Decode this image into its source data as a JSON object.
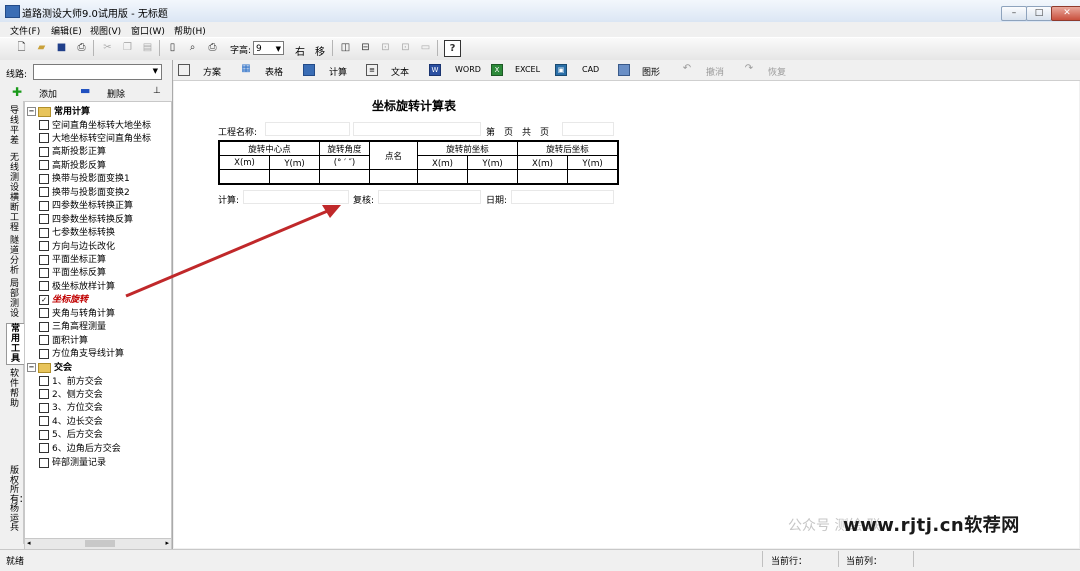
{
  "window": {
    "title": "道路测设大师9.0试用版 - 无标题",
    "controls": [
      "–",
      "□",
      "✕"
    ]
  },
  "menu": [
    "文件(F)",
    "编辑(E)",
    "视图(V)",
    "窗口(W)",
    "帮助(H)"
  ],
  "toolbar": {
    "font_size_label": "字高:",
    "font_size_value": "9",
    "right_label": "右",
    "move_label": "移"
  },
  "left_panel": {
    "route_label": "线路:",
    "add_label": "添加",
    "delete_label": "删除",
    "side_tabs": [
      "导线平差",
      "无线测设",
      "横断工程",
      "隧道分析",
      "局部测设",
      "常用工具",
      "软件帮助",
      "版权所有：杨运兵"
    ],
    "active_side_tab": "常用工具",
    "tree": {
      "group1": "常用计算",
      "group1_items": [
        "空间直角坐标转大地坐标",
        "大地坐标转空间直角坐标",
        "高斯投影正算",
        "高斯投影反算",
        "换带与投影面变换1",
        "换带与投影面变换2",
        "四参数坐标转换正算",
        "四参数坐标转换反算",
        "七参数坐标转换",
        "方向与边长改化",
        "平面坐标正算",
        "平面坐标反算",
        "极坐标放样计算",
        "坐标旋转",
        "夹角与转角计算",
        "三角高程测量",
        "面积计算",
        "方位角支导线计算"
      ],
      "selected_item": "坐标旋转",
      "group2": "交会",
      "group2_items": [
        "1、前方交会",
        "2、侧方交会",
        "3、方位交会",
        "4、边长交会",
        "5、后方交会",
        "6、边角后方交会"
      ],
      "extra_item": "碎部测量记录"
    }
  },
  "doc_toolbar": {
    "items": [
      "方案",
      "表格",
      "计算",
      "文本",
      "WORD",
      "EXCEL",
      "CAD",
      "图形",
      "撤消",
      "恢复"
    ]
  },
  "report": {
    "title": "坐标旋转计算表",
    "project_label": "工程名称:",
    "page_label": "第　页　共　页",
    "h_center": "旋转中心点",
    "h_angle": "旋转角度",
    "h_angle_unit": "(° ′ ″)",
    "h_point": "点名",
    "h_before": "旋转前坐标",
    "h_after": "旋转后坐标",
    "h_x_m": "X(m)",
    "h_y_m": "Y(ｍ)",
    "h_x_m2": "X(ｍ)",
    "h_y_m2": "Y(ｍ)",
    "h_x_m3": "X(ｍ)",
    "h_y_m3": "Y(ｍ)",
    "calc_label": "计算:",
    "review_label": "复核:",
    "date_label": "日期:"
  },
  "statusbar": {
    "ready": "就绪",
    "current_row": "当前行：",
    "current_col": "当前列："
  },
  "watermark": {
    "faint": "公众号 测绘 联",
    "text": "www.rjtj.cn软荐网"
  },
  "colors": {
    "selected_item": "#c00000",
    "arrow": "#c0282a"
  }
}
